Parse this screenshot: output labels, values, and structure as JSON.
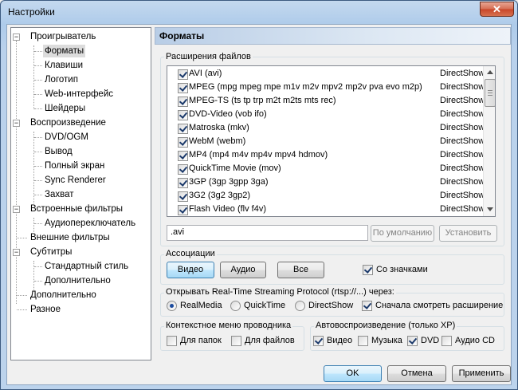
{
  "window": {
    "title": "Настройки",
    "close_glyph": "✕"
  },
  "tree": {
    "items": [
      {
        "label": "Проигрыватель"
      },
      {
        "label": "Форматы"
      },
      {
        "label": "Клавиши"
      },
      {
        "label": "Логотип"
      },
      {
        "label": "Web-интерфейс"
      },
      {
        "label": "Шейдеры"
      },
      {
        "label": "Воспроизведение"
      },
      {
        "label": "DVD/OGM"
      },
      {
        "label": "Вывод"
      },
      {
        "label": "Полный экран"
      },
      {
        "label": "Sync Renderer"
      },
      {
        "label": "Захват"
      },
      {
        "label": "Встроенные фильтры"
      },
      {
        "label": "Аудиопереключатель"
      },
      {
        "label": "Внешние фильтры"
      },
      {
        "label": "Субтитры"
      },
      {
        "label": "Стандартный стиль"
      },
      {
        "label": "Дополнительно"
      },
      {
        "label": "Дополнительно"
      },
      {
        "label": "Разное"
      }
    ],
    "selected": "Форматы"
  },
  "page": {
    "title": "Форматы",
    "extensions_group": "Расширения файлов",
    "extensions": [
      {
        "name": "AVI (avi)",
        "type": "DirectShow"
      },
      {
        "name": "MPEG (mpg mpeg mpe m1v m2v mpv2 mp2v pva evo m2p)",
        "type": "DirectShow"
      },
      {
        "name": "MPEG-TS (ts tp trp m2t m2ts mts rec)",
        "type": "DirectShow"
      },
      {
        "name": "DVD-Video (vob ifo)",
        "type": "DirectShow"
      },
      {
        "name": "Matroska (mkv)",
        "type": "DirectShow"
      },
      {
        "name": "WebM (webm)",
        "type": "DirectShow"
      },
      {
        "name": "MP4 (mp4 m4v mp4v mpv4 hdmov)",
        "type": "DirectShow"
      },
      {
        "name": "QuickTime Movie (mov)",
        "type": "DirectShow"
      },
      {
        "name": "3GP (3gp 3gpp 3ga)",
        "type": "DirectShow"
      },
      {
        "name": "3G2 (3g2 3gp2)",
        "type": "DirectShow"
      },
      {
        "name": "Flash Video (flv f4v)",
        "type": "DirectShow"
      }
    ],
    "extension_value": ".avi",
    "default_button": "По умолчанию",
    "set_button": "Установить",
    "associations_group": "Ассоциации",
    "video_button": "Видео",
    "audio_button": "Аудио",
    "all_button": "Все",
    "with_icons": "Со значками",
    "rtsp_group": "Открывать Real-Time Streaming Protocol (rtsp://...) через:",
    "rtsp_options": [
      "RealMedia",
      "QuickTime",
      "DirectShow"
    ],
    "rtsp_selected": "RealMedia",
    "check_ext_first": "Сначала смотреть расширение",
    "context_group": "Контекстное меню проводника",
    "for_folders": "Для папок",
    "for_files": "Для файлов",
    "autoplay_group": "Автовоспроизведение (только XP)",
    "autoplay_video": "Видео",
    "autoplay_music": "Музыка",
    "autoplay_dvd": "DVD",
    "autoplay_audiocd": "Аудио CD"
  },
  "footer": {
    "ok": "OK",
    "cancel": "Отмена",
    "apply": "Применить"
  }
}
